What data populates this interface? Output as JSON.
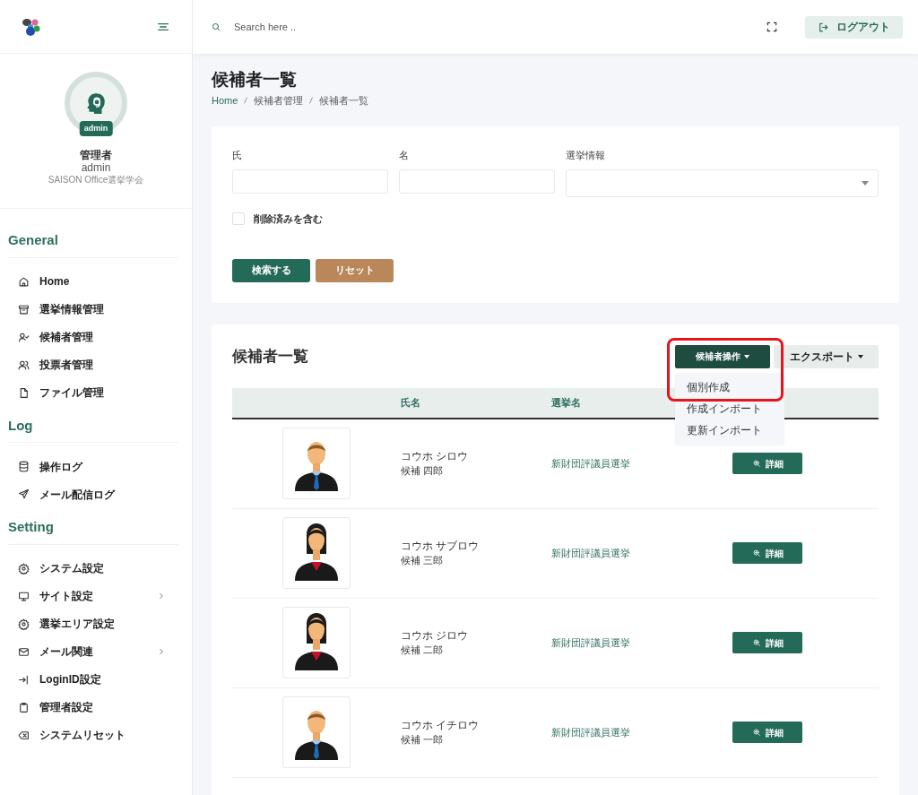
{
  "sidebar": {
    "user": {
      "badge": "admin",
      "role": "管理者",
      "login": "admin",
      "organization": "SAISON Office選挙学会"
    },
    "sections": [
      {
        "title": "General",
        "items": [
          {
            "label": "Home",
            "submenu": false
          },
          {
            "label": "選挙情報管理",
            "submenu": false
          },
          {
            "label": "候補者管理",
            "submenu": false
          },
          {
            "label": "投票者管理",
            "submenu": false
          },
          {
            "label": "ファイル管理",
            "submenu": false
          }
        ]
      },
      {
        "title": "Log",
        "items": [
          {
            "label": "操作ログ",
            "submenu": false
          },
          {
            "label": "メール配信ログ",
            "submenu": false
          }
        ]
      },
      {
        "title": "Setting",
        "items": [
          {
            "label": "システム設定",
            "submenu": false
          },
          {
            "label": "サイト設定",
            "submenu": true
          },
          {
            "label": "選挙エリア設定",
            "submenu": false
          },
          {
            "label": "メール関連",
            "submenu": true
          },
          {
            "label": "LoginID設定",
            "submenu": false
          },
          {
            "label": "管理者設定",
            "submenu": false
          },
          {
            "label": "システムリセット",
            "submenu": false
          }
        ]
      }
    ]
  },
  "header": {
    "search": {
      "placeholder": "Search here .."
    },
    "logout": "ログアウト"
  },
  "page": {
    "title": "候補者一覧",
    "breadcrumb": [
      "Home",
      "候補者管理",
      "候補者一覧"
    ]
  },
  "filter": {
    "fields": [
      {
        "label": "氏",
        "kind": "text"
      },
      {
        "label": "名",
        "kind": "text"
      },
      {
        "label": "選挙情報",
        "kind": "select"
      }
    ],
    "include_deleted": {
      "label": "削除済みを含む",
      "checked": false
    },
    "buttons": [
      {
        "label": "検索する",
        "kind": "primary"
      },
      {
        "label": "リセット",
        "kind": "secondary"
      }
    ]
  },
  "list": {
    "title": "候補者一覧",
    "candidate_actions": {
      "label": "候補者操作",
      "expanded": true,
      "highlighted": true,
      "items": [
        "個別作成",
        "作成インポート",
        "更新インポート"
      ]
    },
    "export": {
      "label": "エクスポート",
      "expanded": false
    },
    "columns": [
      "氏名",
      "選挙名"
    ],
    "rows": [
      {
        "kind": "male",
        "kana": "コウホ シロウ",
        "name": "候補 四郎",
        "election": "新財団評議員選挙",
        "action": "詳細"
      },
      {
        "kind": "female",
        "kana": "コウホ サブロウ",
        "name": "候補 三郎",
        "election": "新財団評議員選挙",
        "action": "詳細"
      },
      {
        "kind": "female",
        "kana": "コウホ ジロウ",
        "name": "候補 二郎",
        "election": "新財団評議員選挙",
        "action": "詳細"
      },
      {
        "kind": "male",
        "kana": "コウホ イチロウ",
        "name": "候補 一郎",
        "election": "新財団評議員選挙",
        "action": "詳細"
      }
    ]
  }
}
